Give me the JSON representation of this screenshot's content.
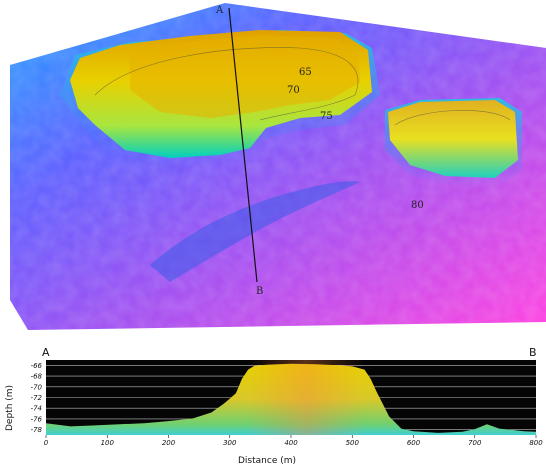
{
  "map": {
    "point_a": "A",
    "point_b": "B",
    "contours": [
      "65",
      "70",
      "75",
      "80"
    ]
  },
  "profile": {
    "point_a": "A",
    "point_b": "B",
    "ylabel": "Depth (m)",
    "xlabel": "Distance (m)",
    "y_ticks": [
      "-66",
      "-68",
      "-70",
      "-72",
      "-74",
      "-76",
      "-78"
    ],
    "x_ticks": [
      "0",
      "100",
      "200",
      "300",
      "400",
      "500",
      "600",
      "700",
      "800"
    ]
  },
  "chart_data": {
    "type": "area",
    "xlabel": "Distance (m)",
    "ylabel": "Depth (m)",
    "xlim": [
      0,
      800
    ],
    "ylim": [
      -79,
      -65
    ],
    "x": [
      0,
      40,
      80,
      120,
      160,
      200,
      240,
      270,
      290,
      300,
      310,
      320,
      330,
      340,
      360,
      400,
      440,
      480,
      500,
      520,
      530,
      540,
      560,
      580,
      600,
      640,
      680,
      700,
      720,
      740,
      780,
      800
    ],
    "y": [
      -76.8,
      -77.4,
      -77.2,
      -77.0,
      -76.8,
      -76.4,
      -75.9,
      -74.8,
      -73.2,
      -72.2,
      -71.2,
      -68.5,
      -66.8,
      -66.1,
      -65.9,
      -65.7,
      -65.8,
      -66.0,
      -66.2,
      -66.8,
      -68.5,
      -71.0,
      -75.5,
      -77.8,
      -78.3,
      -78.6,
      -78.4,
      -77.9,
      -77.0,
      -77.8,
      -78.3,
      -78.4
    ]
  }
}
